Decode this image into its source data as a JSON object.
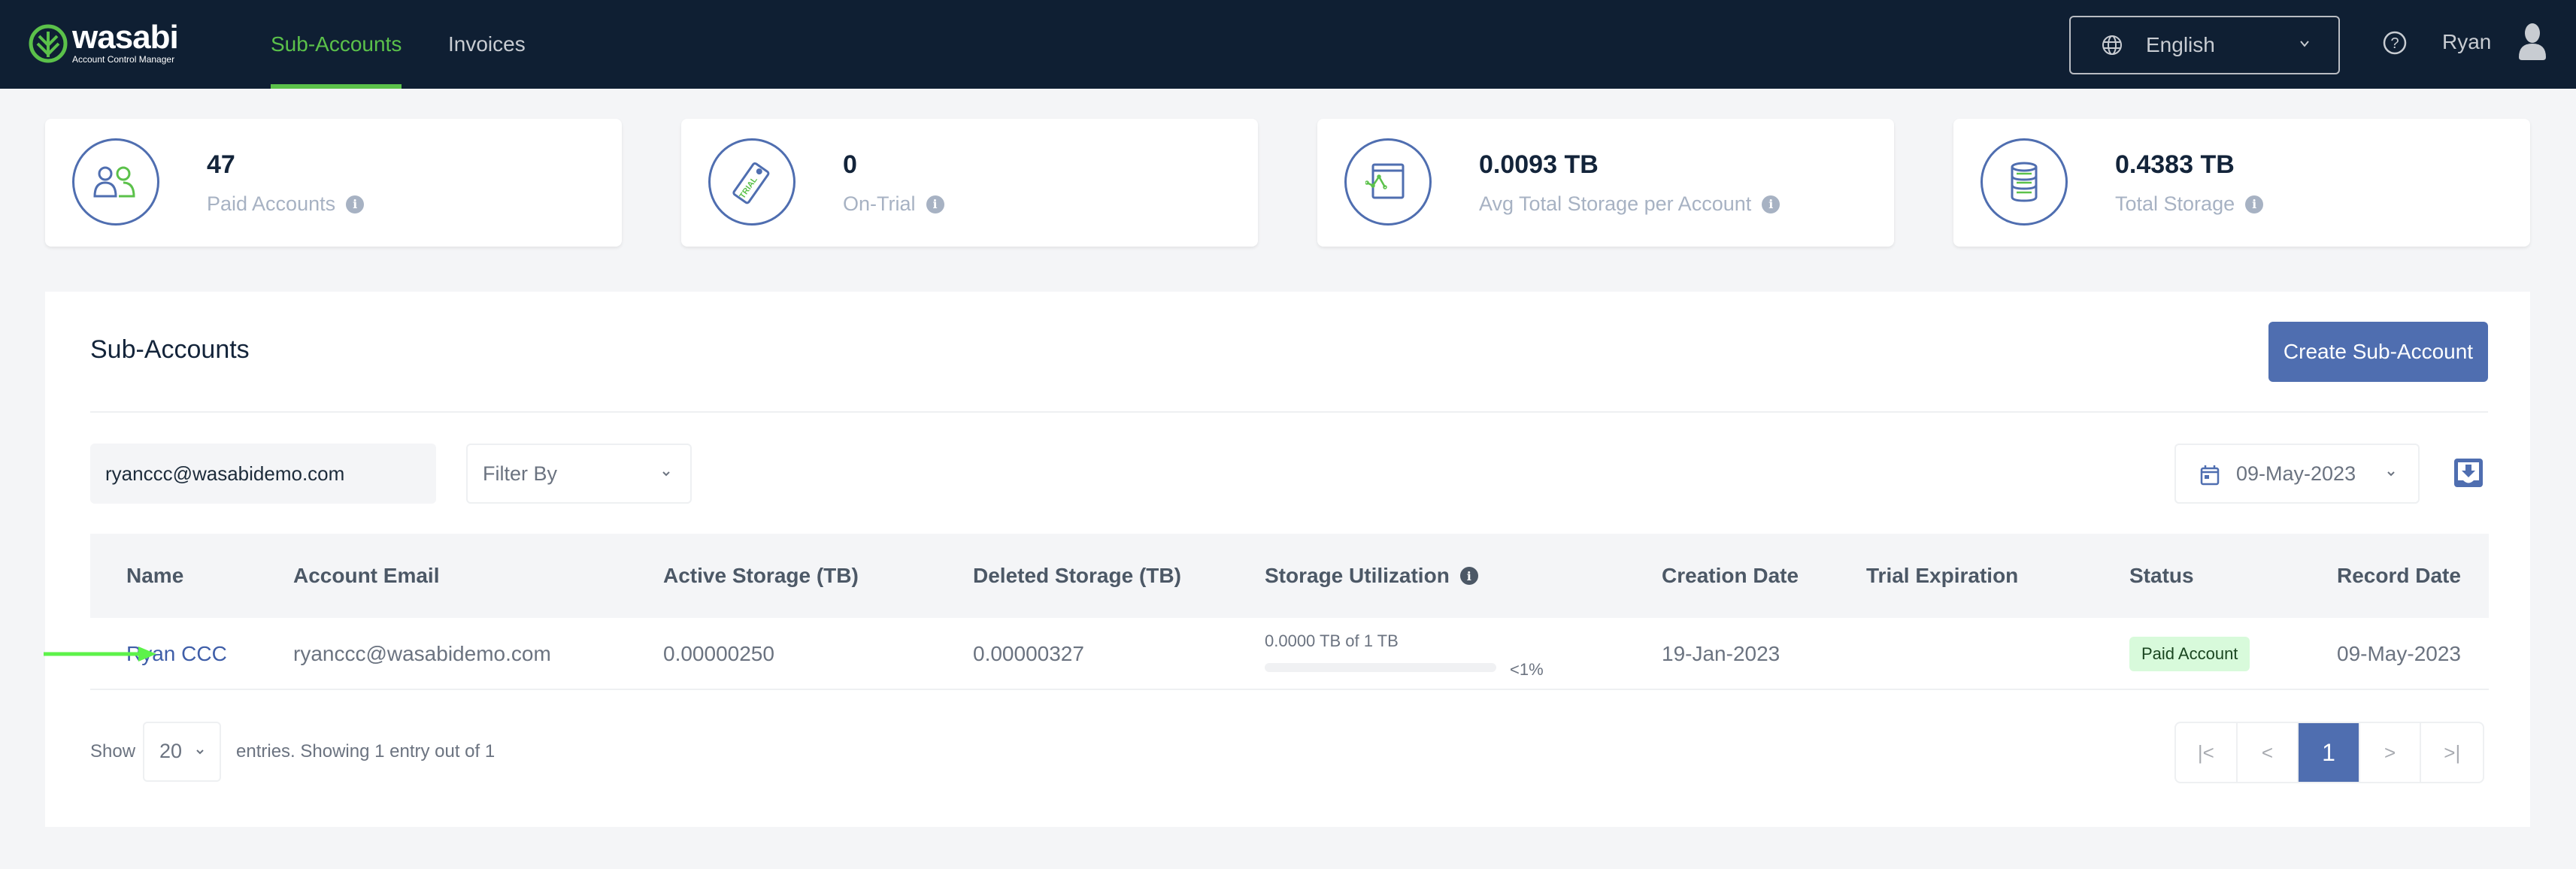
{
  "header": {
    "logo_word": "wasabi",
    "logo_sub": "Account Control Manager",
    "tabs": [
      {
        "label": "Sub-Accounts",
        "active": true
      },
      {
        "label": "Invoices",
        "active": false
      }
    ],
    "language": "English",
    "user_name": "Ryan"
  },
  "stats": [
    {
      "value": "47",
      "label": "Paid Accounts",
      "icon": "users-icon"
    },
    {
      "value": "0",
      "label": "On-Trial",
      "icon": "trial-tag-icon"
    },
    {
      "value": "0.0093 TB",
      "label": "Avg Total Storage per Account",
      "icon": "chart-window-icon"
    },
    {
      "value": "0.4383 TB",
      "label": "Total Storage",
      "icon": "database-icon"
    }
  ],
  "panel": {
    "title": "Sub-Accounts",
    "create_button": "Create Sub-Account",
    "search_value": "ryanccc@wasabidemo.com",
    "filter_placeholder": "Filter By",
    "date_value": "09-May-2023"
  },
  "table": {
    "columns": [
      "Name",
      "Account Email",
      "Active Storage (TB)",
      "Deleted Storage (TB)",
      "Storage Utilization",
      "Creation Date",
      "Trial Expiration",
      "Status",
      "Record Date"
    ],
    "rows": [
      {
        "name": "Ryan CCC",
        "email": "ryanccc@wasabidemo.com",
        "active_storage": "0.00000250",
        "deleted_storage": "0.00000327",
        "utilization_text": "0.0000 TB of 1 TB",
        "utilization_fraction": 0.0,
        "utilization_pct": "<1%",
        "creation_date": "19-Jan-2023",
        "trial_expiration": "",
        "status": "Paid Account",
        "record_date": "09-May-2023"
      }
    ]
  },
  "footer": {
    "show_label": "Show",
    "page_size": "20",
    "entries_label": "entries.  Showing 1 entry out of 1",
    "current_page": "1",
    "pager": {
      "first": "|<",
      "prev": "<",
      "next": ">",
      "last": ">|"
    }
  },
  "colors": {
    "nav_bg": "#0f1f33",
    "accent_green": "#5bc14a",
    "primary_blue": "#4f6eb0",
    "badge_green_bg": "#d8fadb"
  }
}
